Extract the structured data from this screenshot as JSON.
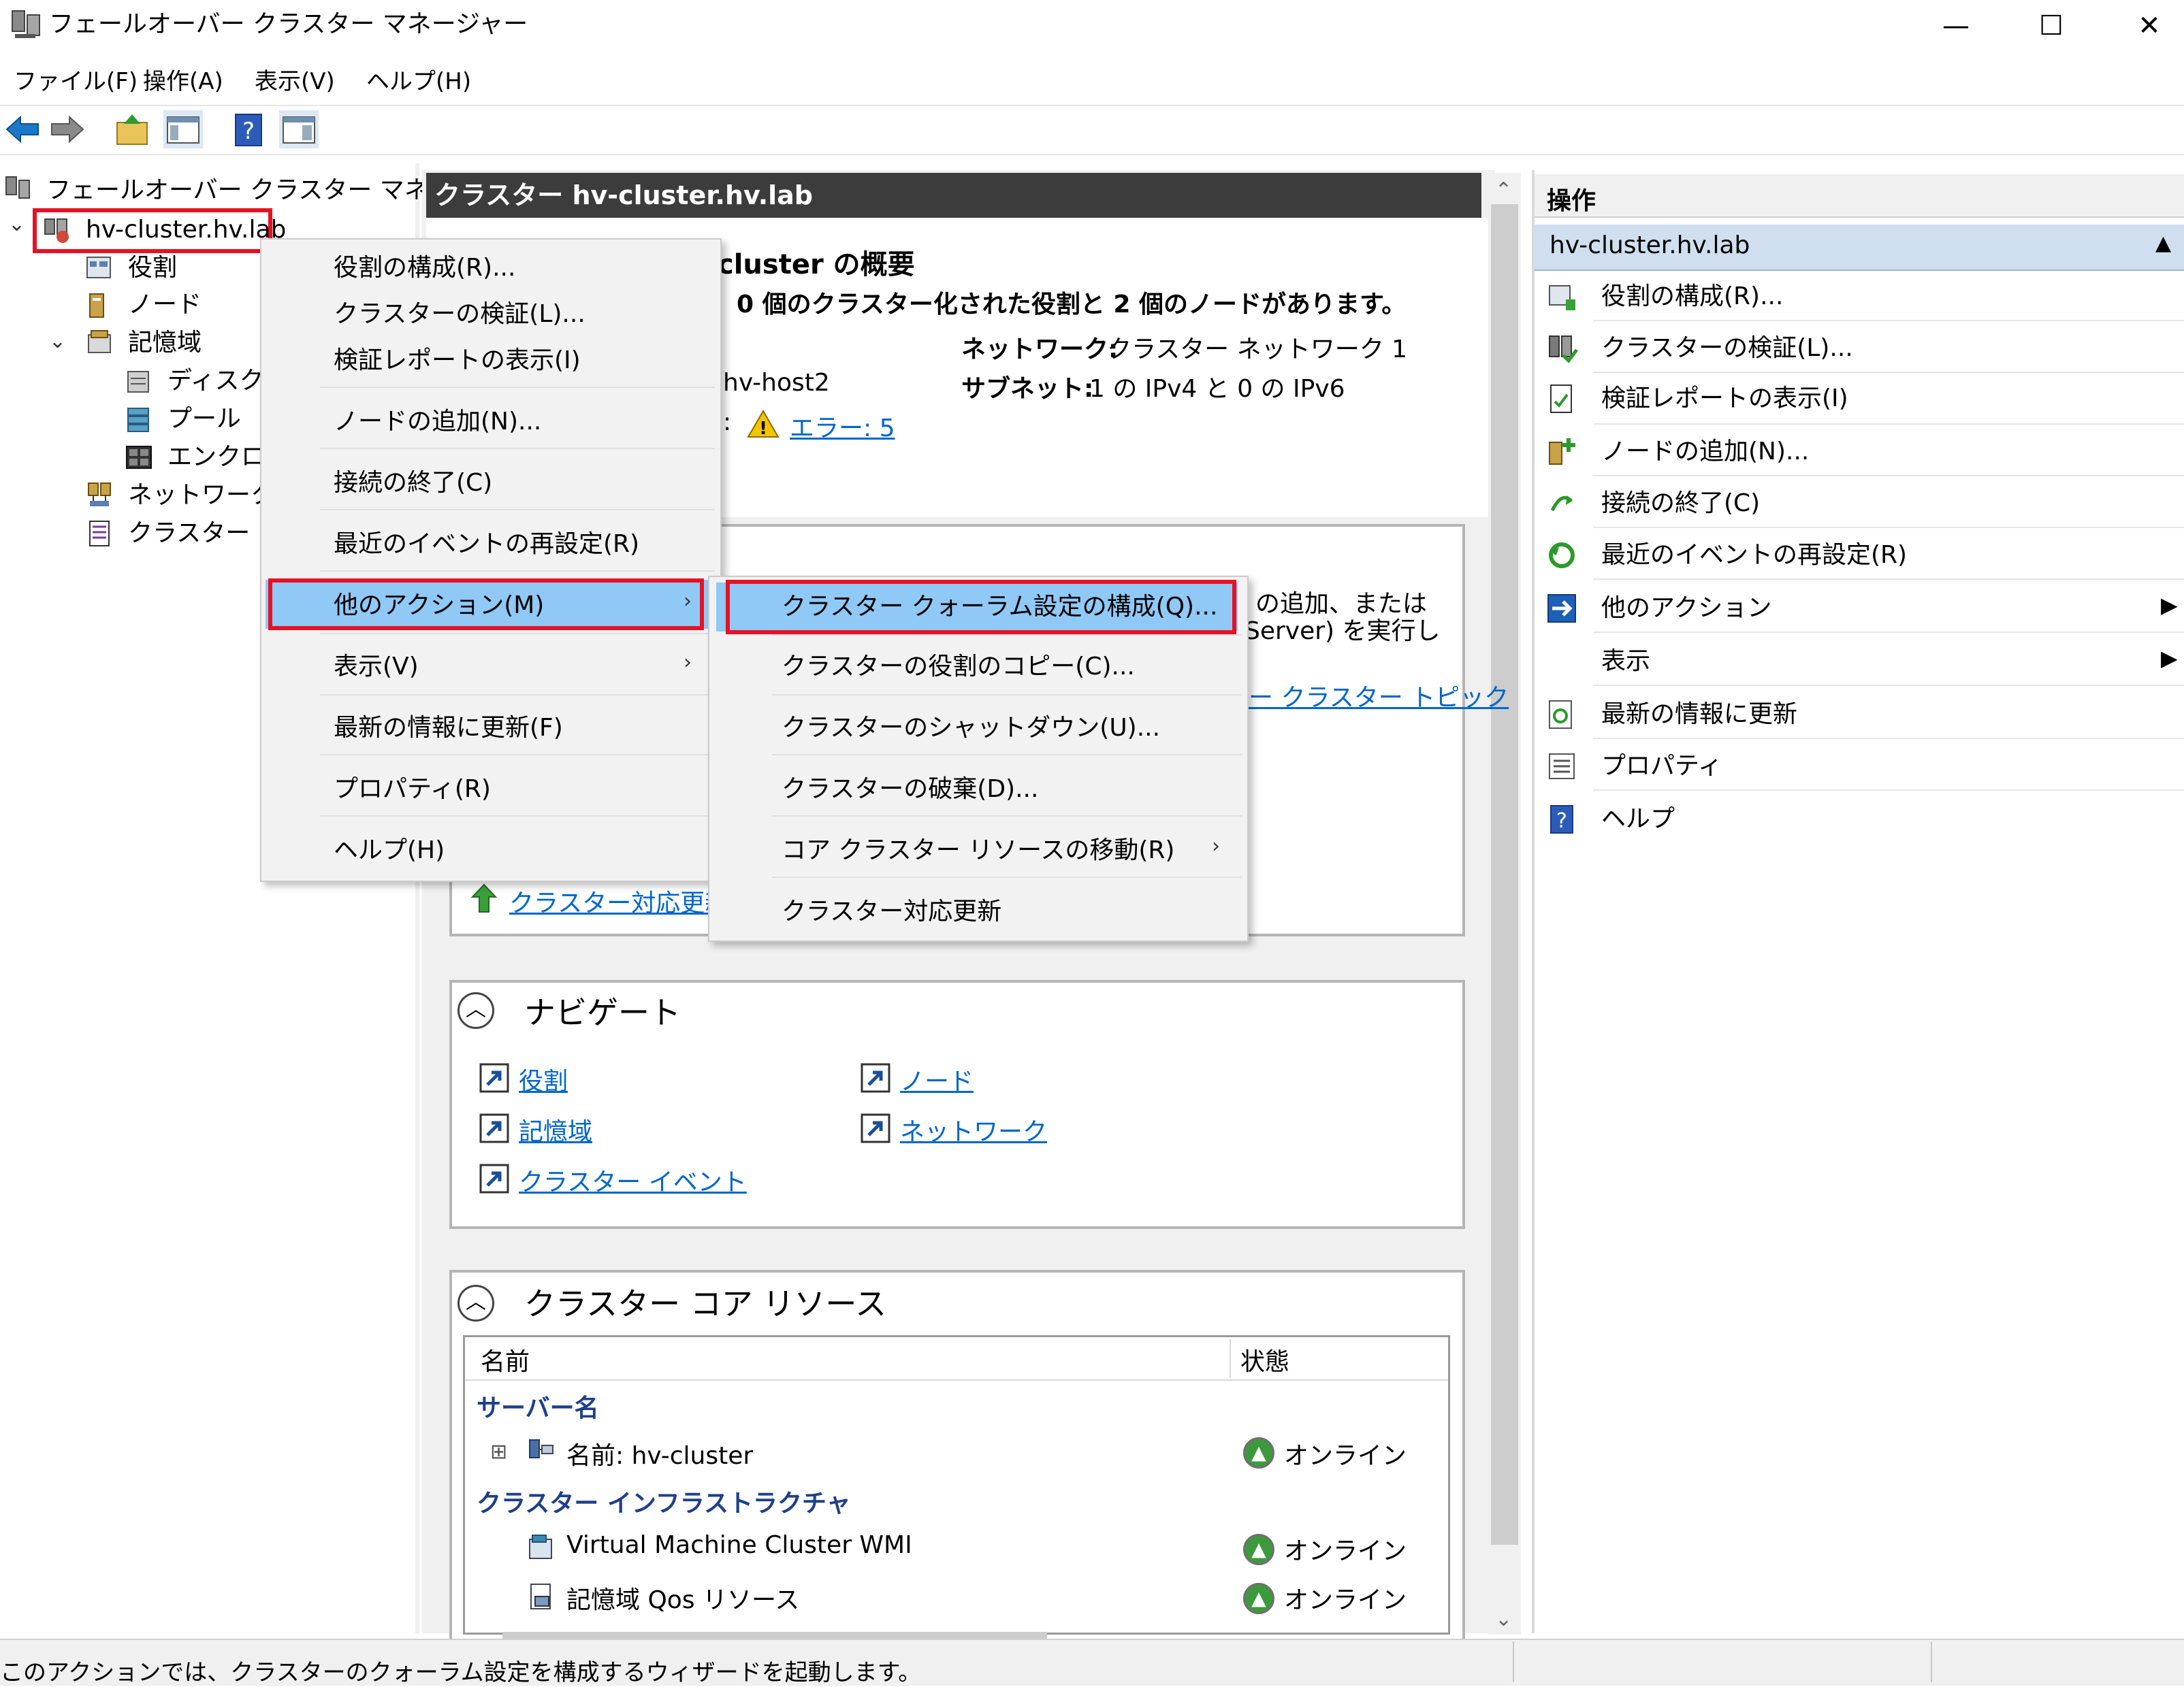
{
  "window": {
    "title": "フェールオーバー クラスター マネージャー",
    "minimize": "—",
    "maximize": "☐",
    "close": "✕"
  },
  "menubar": [
    "ファイル(F)",
    "操作(A)",
    "表示(V)",
    "ヘルプ(H)"
  ],
  "tree": {
    "root": "フェールオーバー クラスター マネージャー",
    "cluster": "hv-cluster.hv.lab",
    "roles": "役割",
    "nodes": "ノード",
    "storage": "記憶域",
    "disks": "ディスク",
    "pools": "プール",
    "enclosures": "エンクロー",
    "networks": "ネットワーク",
    "events": "クラスター イベ"
  },
  "center": {
    "header": "クラスター hv-cluster.hv.lab",
    "summary_title": "cluster の概要",
    "summary_line": "、0 個のクラスター化された役割と 2 個のノードがあります。",
    "network_label": "ネットワーク:",
    "network_value": "クラスター ネットワーク 1",
    "subnet_label": "サブネット:",
    "subnet_value": "1 の IPv4 と 0 の IPv6",
    "host_value": "hv-host2",
    "events_prefix": ":",
    "events_link": "エラー: 5",
    "config_text1": "の追加、または",
    "config_text2": "Server) を実行し",
    "topic_link": "ー クラスター トピック",
    "cau_link": "クラスター対応更新",
    "navigate_title": "ナビゲート",
    "nav_links": [
      "役割",
      "ノード",
      "記憶域",
      "ネットワーク",
      "クラスター イベント"
    ],
    "core_title": "クラスター コア リソース",
    "col_name": "名前",
    "col_status": "状態",
    "group_server": "サーバー名",
    "server_item": "名前: hv-cluster",
    "group_infra": "クラスター インフラストラクチャ",
    "infra_item1": "Virtual Machine Cluster WMI",
    "infra_item2": "記憶域 Qos リソース",
    "online": "オンライン",
    "expand": "⊞"
  },
  "actions": {
    "header": "操作",
    "section": "hv-cluster.hv.lab",
    "items": [
      "役割の構成(R)...",
      "クラスターの検証(L)...",
      "検証レポートの表示(I)",
      "ノードの追加(N)...",
      "接続の終了(C)",
      "最近のイベントの再設定(R)",
      "他のアクション",
      "表示",
      "最新の情報に更新",
      "プロパティ",
      "ヘルプ"
    ]
  },
  "context_menu": {
    "items": [
      "役割の構成(R)...",
      "クラスターの検証(L)...",
      "検証レポートの表示(I)",
      "ノードの追加(N)...",
      "接続の終了(C)",
      "最近のイベントの再設定(R)",
      "他のアクション(M)",
      "表示(V)",
      "最新の情報に更新(F)",
      "プロパティ(R)",
      "ヘルプ(H)"
    ]
  },
  "submenu": {
    "items": [
      "クラスター クォーラム設定の構成(Q)...",
      "クラスターの役割のコピー(C)...",
      "クラスターのシャットダウン(U)...",
      "クラスターの破棄(D)...",
      "コア クラスター リソースの移動(R)",
      "クラスター対応更新"
    ]
  },
  "statusbar": {
    "text": "このアクションでは、クラスターのクォーラム設定を構成するウィザードを起動します。"
  },
  "colors": {
    "highlight": "#90c8f6",
    "red_outline": "#e81123",
    "link": "#0066cc",
    "header_dark": "#3c3c3c",
    "actions_section": "#cfdff0"
  }
}
